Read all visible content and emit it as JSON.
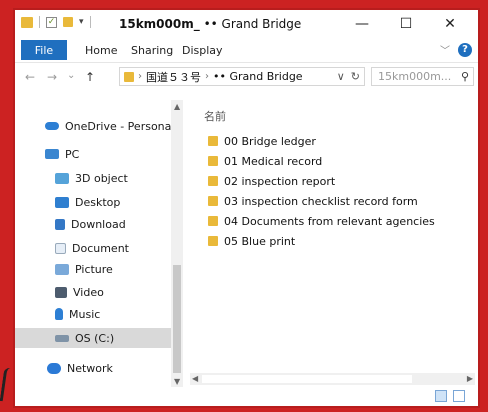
{
  "window": {
    "title_bold": "15km000m_",
    "title_rest": "•• Grand Bridge",
    "minimize_glyph": "—",
    "maximize_glyph": "☐",
    "close_glyph": "✕"
  },
  "ribbon": {
    "tabs": [
      "File",
      "Home",
      "Sharing",
      "Display"
    ]
  },
  "address": {
    "segments": [
      "国道５３号",
      "•• Grand Bridge"
    ],
    "search_placeholder": "15km000m...",
    "back_glyph": "←",
    "forward_glyph": "→",
    "recent_glyph": "⌄",
    "up_glyph": "↑"
  },
  "sidebar": {
    "items": [
      {
        "label": "OneDrive - Personal",
        "icon": "cloud-icon"
      },
      {
        "label": "PC",
        "icon": "pc-icon"
      },
      {
        "label": "3D object",
        "icon": "3d-object-icon"
      },
      {
        "label": "Desktop",
        "icon": "desktop-icon"
      },
      {
        "label": "Download",
        "icon": "download-icon"
      },
      {
        "label": "Document",
        "icon": "document-icon"
      },
      {
        "label": "Picture",
        "icon": "picture-icon"
      },
      {
        "label": "Video",
        "icon": "video-icon"
      },
      {
        "label": "Music",
        "icon": "music-icon"
      },
      {
        "label": "OS (C:)",
        "icon": "disk-icon"
      },
      {
        "label": "Network",
        "icon": "network-icon"
      }
    ]
  },
  "content": {
    "column_header": "名前",
    "files": [
      "00 Bridge ledger",
      "01 Medical record",
      "02 inspection report",
      "03 inspection checklist record form",
      "04 Documents from relevant agencies",
      "05 Blue print"
    ]
  },
  "colors": {
    "accent": "#1f6fbf",
    "folder": "#e9b93a",
    "border": "#b81d1d",
    "selection": "#d9d9d9"
  }
}
